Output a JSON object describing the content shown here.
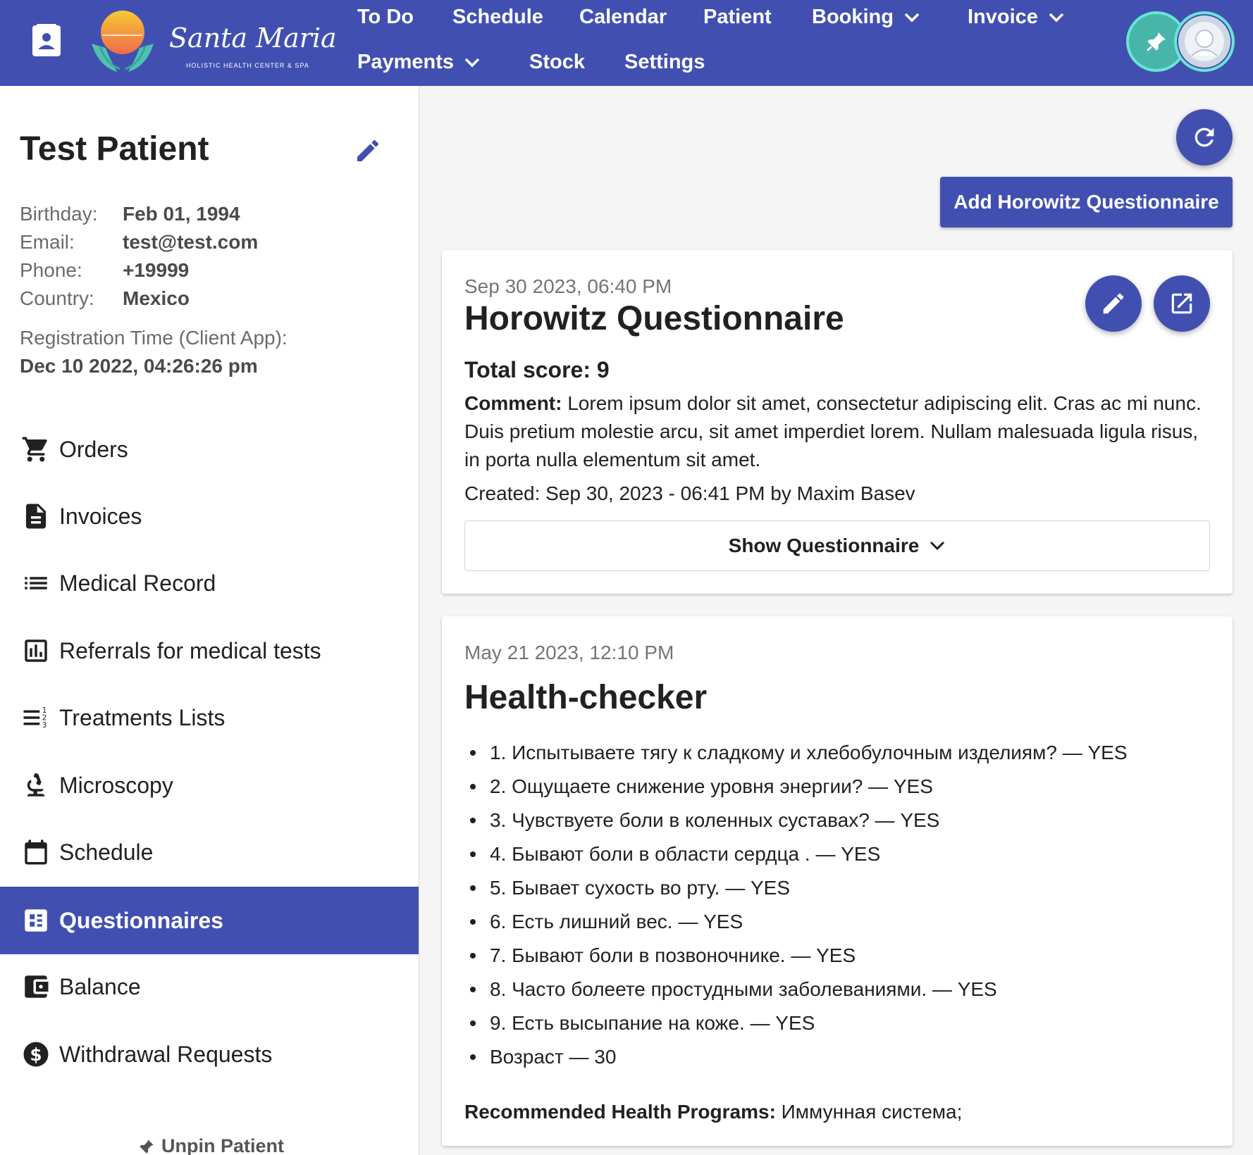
{
  "brand": {
    "name": "Santa Maria",
    "tagline": "HOLISTIC HEALTH CENTER & SPA"
  },
  "nav": {
    "todo": "To Do",
    "schedule": "Schedule",
    "calendar": "Calendar",
    "patient": "Patient",
    "booking": "Booking",
    "invoice": "Invoice",
    "payments": "Payments",
    "stock": "Stock",
    "settings": "Settings"
  },
  "patient": {
    "name": "Test Patient",
    "fields": {
      "birthday_label": "Birthday:",
      "birthday_value": "Feb 01, 1994",
      "email_label": "Email:",
      "email_value": "test@test.com",
      "phone_label": "Phone:",
      "phone_value": "+19999",
      "country_label": "Country:",
      "country_value": "Mexico"
    },
    "registration_label": "Registration Time (Client App):",
    "registration_value": "Dec 10 2022, 04:26:26 pm"
  },
  "sidebar": {
    "items": [
      {
        "label": "Orders",
        "icon": "cart-icon"
      },
      {
        "label": "Invoices",
        "icon": "document-icon"
      },
      {
        "label": "Medical Record",
        "icon": "list-icon"
      },
      {
        "label": "Referrals for medical tests",
        "icon": "bar-chart-icon"
      },
      {
        "label": "Treatments Lists",
        "icon": "numbered-list-icon"
      },
      {
        "label": "Microscopy",
        "icon": "microscope-icon"
      },
      {
        "label": "Schedule",
        "icon": "calendar-icon"
      },
      {
        "label": "Questionnaires",
        "icon": "dashboard-icon",
        "active": true
      },
      {
        "label": "Balance",
        "icon": "wallet-icon"
      },
      {
        "label": "Withdrawal Requests",
        "icon": "dollar-icon"
      }
    ],
    "unpin": "Unpin Patient"
  },
  "main": {
    "add_button": "Add Horowitz Questionnaire",
    "horowitz": {
      "date": "Sep 30 2023, 06:40 PM",
      "title": "Horowitz Questionnaire",
      "total_score": "Total score: 9",
      "comment_label": "Comment:",
      "comment_text": " Lorem ipsum dolor sit amet, consectetur adipiscing elit. Cras ac mi nunc. Duis pretium molestie arcu, sit amet imperdiet lorem. Nullam malesuada ligula risus, in porta nulla elementum sit amet.",
      "created": "Created: Sep 30, 2023 - 06:41 PM by Maxim Basev",
      "show_button": "Show Questionnaire"
    },
    "health_checker": {
      "date": "May 21 2023, 12:10 PM",
      "title": "Health-checker",
      "items": [
        "1. Испытываете тягу к сладкому и хлебобулочным изделиям? — YES",
        "2. Ощущаете снижение уровня энергии? — YES",
        "3. Чувствуете боли в коленных суставах? — YES",
        "4. Бывают боли в области сердца . — YES",
        "5. Бывает сухость во рту. — YES",
        "6. Есть лишний вес. — YES",
        "7. Бывают боли в позвоночнике. — YES",
        "8. Часто болеете простудными заболеваниями. — YES",
        "9. Есть высыпание на коже. — YES",
        "Возраст — 30"
      ],
      "recommended_label": "Recommended Health Programs:",
      "recommended_value": " Иммунная система;"
    }
  },
  "colors": {
    "primary": "#4150b0",
    "accent_teal": "#6ae4d4"
  }
}
